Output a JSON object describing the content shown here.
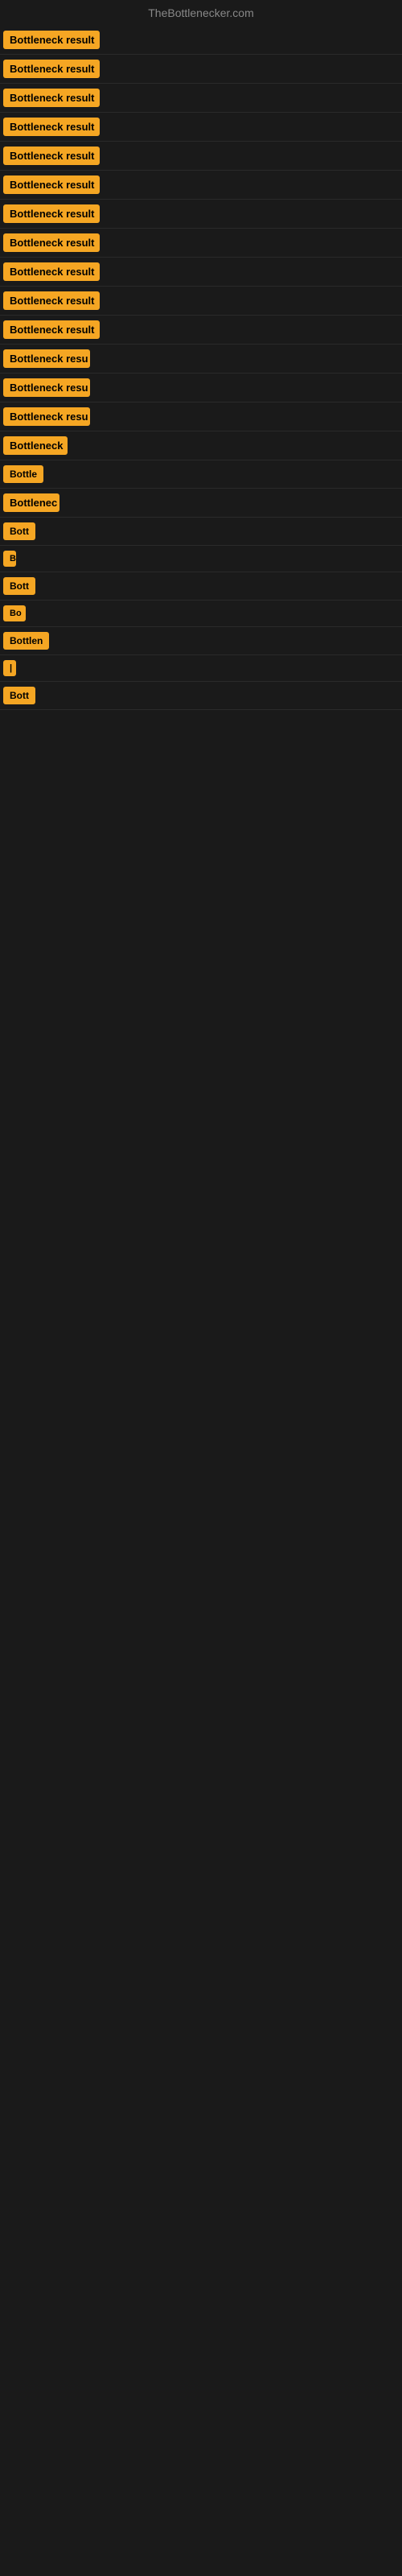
{
  "site": {
    "title": "TheBottlenecker.com"
  },
  "rows": [
    {
      "id": 1,
      "label": "Bottleneck result",
      "width": 120
    },
    {
      "id": 2,
      "label": "Bottleneck result",
      "width": 120
    },
    {
      "id": 3,
      "label": "Bottleneck result",
      "width": 120
    },
    {
      "id": 4,
      "label": "Bottleneck result",
      "width": 120
    },
    {
      "id": 5,
      "label": "Bottleneck result",
      "width": 120
    },
    {
      "id": 6,
      "label": "Bottleneck result",
      "width": 120
    },
    {
      "id": 7,
      "label": "Bottleneck result",
      "width": 120
    },
    {
      "id": 8,
      "label": "Bottleneck result",
      "width": 120
    },
    {
      "id": 9,
      "label": "Bottleneck result",
      "width": 120
    },
    {
      "id": 10,
      "label": "Bottleneck result",
      "width": 120
    },
    {
      "id": 11,
      "label": "Bottleneck result",
      "width": 120
    },
    {
      "id": 12,
      "label": "Bottleneck resu",
      "width": 108
    },
    {
      "id": 13,
      "label": "Bottleneck resu",
      "width": 108
    },
    {
      "id": 14,
      "label": "Bottleneck resu",
      "width": 108
    },
    {
      "id": 15,
      "label": "Bottleneck",
      "width": 80
    },
    {
      "id": 16,
      "label": "Bottle",
      "width": 55
    },
    {
      "id": 17,
      "label": "Bottlenec",
      "width": 70
    },
    {
      "id": 18,
      "label": "Bott",
      "width": 42
    },
    {
      "id": 19,
      "label": "B",
      "width": 16
    },
    {
      "id": 20,
      "label": "Bott",
      "width": 42
    },
    {
      "id": 21,
      "label": "Bo",
      "width": 28
    },
    {
      "id": 22,
      "label": "Bottlen",
      "width": 58
    },
    {
      "id": 23,
      "label": "|",
      "width": 8
    },
    {
      "id": 24,
      "label": "Bott",
      "width": 42
    }
  ],
  "colors": {
    "badge_bg": "#f5a623",
    "badge_text": "#000000",
    "bg": "#1a1a1a",
    "title": "#888888"
  }
}
